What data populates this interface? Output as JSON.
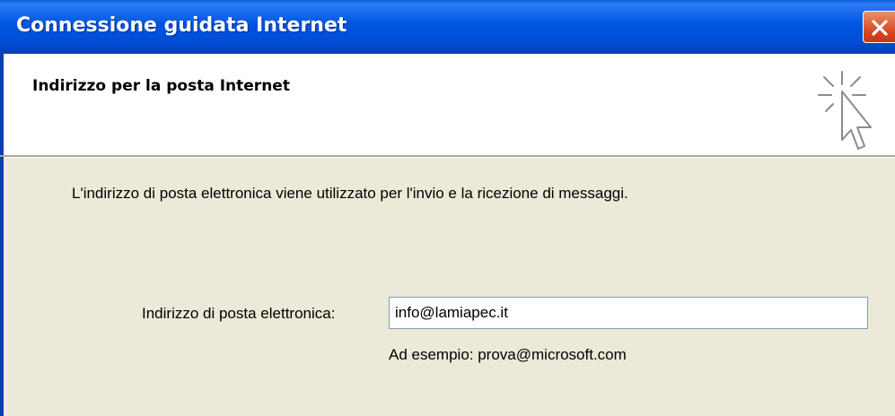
{
  "window": {
    "title": "Connessione guidata Internet"
  },
  "header": {
    "title": "Indirizzo per la posta Internet",
    "icon": "wizard-cursor-icon"
  },
  "content": {
    "description": "L'indirizzo di posta elettronica viene utilizzato per l'invio e la ricezione di messaggi.",
    "email_label": "Indirizzo di posta elettronica:",
    "email_value": "info@lamiapec.it",
    "example": "Ad esempio: prova@microsoft.com"
  },
  "colors": {
    "titlebar": "#0054E3",
    "close_button": "#E1633B",
    "dialog_background": "#ECE9D8",
    "header_background": "#FFFFFF"
  }
}
